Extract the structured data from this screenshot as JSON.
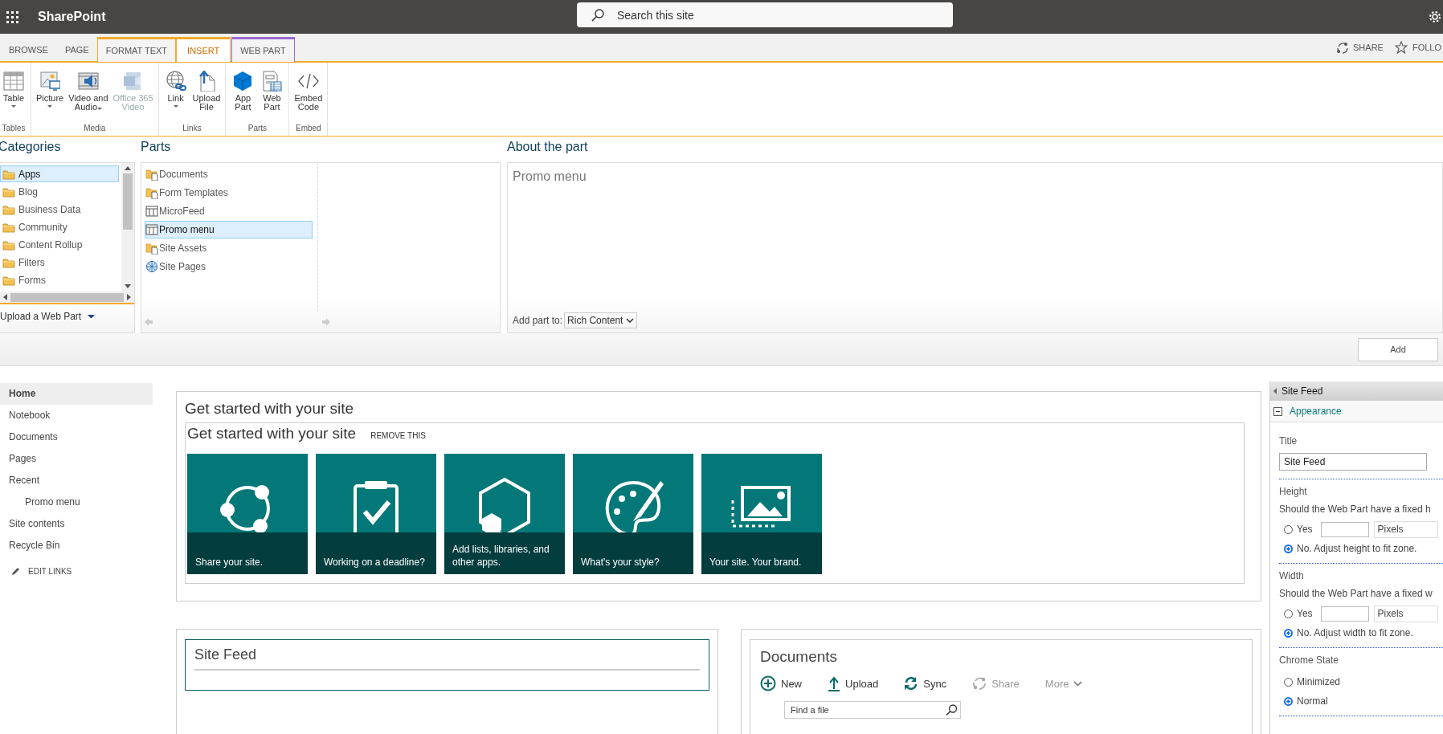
{
  "top_bar": {
    "app_name": "SharePoint",
    "search": {
      "placeholder": "Search this site"
    }
  },
  "ribbon_tabs": [
    {
      "label": "BROWSE",
      "selected": false,
      "kind": "plain"
    },
    {
      "label": "PAGE",
      "selected": false,
      "kind": "plain"
    },
    {
      "label": "FORMAT TEXT",
      "selected": false,
      "kind": "editing"
    },
    {
      "label": "INSERT",
      "selected": true,
      "kind": "editing"
    },
    {
      "label": "WEB PART",
      "selected": false,
      "kind": "webpart"
    }
  ],
  "page_actions": [
    {
      "label": "SHARE",
      "kind": "share"
    },
    {
      "label": "FOLLO",
      "kind": "follow"
    }
  ],
  "ribbon_groups": [
    {
      "label": "Tables",
      "commands": [
        {
          "lines": [
            "Table"
          ],
          "kind": "table",
          "dropdown": true,
          "disabled": false
        }
      ]
    },
    {
      "label": "Media",
      "commands": [
        {
          "lines": [
            "Picture"
          ],
          "kind": "picture",
          "dropdown": true,
          "disabled": false
        },
        {
          "lines": [
            "Video and",
            "Audio"
          ],
          "kind": "video",
          "dropdown": true,
          "disabled": false
        },
        {
          "lines": [
            "Office 365",
            "Video"
          ],
          "kind": "office-video",
          "dropdown": false,
          "disabled": true
        }
      ]
    },
    {
      "label": "Links",
      "commands": [
        {
          "lines": [
            "Link"
          ],
          "kind": "link",
          "dropdown": true,
          "disabled": false
        },
        {
          "lines": [
            "Upload",
            "File"
          ],
          "kind": "upload",
          "dropdown": false,
          "disabled": false
        }
      ]
    },
    {
      "label": "Parts",
      "commands": [
        {
          "lines": [
            "App",
            "Part"
          ],
          "kind": "app-part",
          "dropdown": false,
          "disabled": false
        },
        {
          "lines": [
            "Web",
            "Part"
          ],
          "kind": "web-part",
          "dropdown": false,
          "disabled": false
        }
      ]
    },
    {
      "label": "Embed",
      "commands": [
        {
          "lines": [
            "Embed",
            "Code"
          ],
          "kind": "embed",
          "dropdown": false,
          "disabled": false
        }
      ]
    }
  ],
  "categories": {
    "title": "Categories",
    "items": [
      {
        "label": "Apps",
        "selected": true
      },
      {
        "label": "Blog",
        "selected": false
      },
      {
        "label": "Business Data",
        "selected": false
      },
      {
        "label": "Community",
        "selected": false
      },
      {
        "label": "Content Rollup",
        "selected": false
      },
      {
        "label": "Filters",
        "selected": false
      },
      {
        "label": "Forms",
        "selected": false
      }
    ],
    "upload_link": "Upload a Web Part"
  },
  "parts": {
    "title": "Parts",
    "items": [
      {
        "label": "Documents",
        "kind": "library",
        "selected": false
      },
      {
        "label": "Form Templates",
        "kind": "library",
        "selected": false
      },
      {
        "label": "MicroFeed",
        "kind": "list",
        "selected": false
      },
      {
        "label": "Promo menu",
        "kind": "list",
        "selected": true
      },
      {
        "label": "Site Assets",
        "kind": "library",
        "selected": false
      },
      {
        "label": "Site Pages",
        "kind": "pages",
        "selected": false
      }
    ]
  },
  "about": {
    "title": "About the part",
    "part_name": "Promo menu",
    "add_to_label": "Add part to:",
    "add_to_value": "Rich Content"
  },
  "add_button": "Add",
  "quick_launch": {
    "items": [
      {
        "label": "Home",
        "selected": true
      },
      {
        "label": "Notebook",
        "selected": false
      },
      {
        "label": "Documents",
        "selected": false
      },
      {
        "label": "Pages",
        "selected": false
      },
      {
        "label": "Recent",
        "selected": false,
        "children": [
          {
            "label": "Promo menu",
            "selected": false
          }
        ]
      },
      {
        "label": "Site contents",
        "selected": false
      },
      {
        "label": "Recycle Bin",
        "selected": false
      }
    ],
    "edit_links": "EDIT LINKS"
  },
  "get_started": {
    "zone_title": "Get started with your site",
    "title": "Get started with your site",
    "remove_link": "REMOVE THIS",
    "tiles": [
      {
        "kind": "share",
        "caption": "Share your site."
      },
      {
        "kind": "deadline",
        "caption": "Working on a deadline?"
      },
      {
        "kind": "apps",
        "caption": "Add lists, libraries, and other apps."
      },
      {
        "kind": "style",
        "caption": "What's your style?"
      },
      {
        "kind": "brand",
        "caption": "Your site. Your brand."
      }
    ]
  },
  "site_feed": {
    "title": "Site Feed"
  },
  "documents": {
    "title": "Documents",
    "actions": [
      {
        "label": "New",
        "kind": "new",
        "disabled": false
      },
      {
        "label": "Upload",
        "kind": "upload",
        "disabled": false
      },
      {
        "label": "Sync",
        "kind": "sync",
        "disabled": false
      },
      {
        "label": "Share",
        "kind": "share",
        "disabled": true
      },
      {
        "label": "More",
        "kind": "more",
        "disabled": true
      }
    ],
    "search": {
      "placeholder": "Find a file"
    }
  },
  "tool_pane": {
    "title": "Site Feed",
    "section": {
      "label": "Appearance",
      "expanded": true
    },
    "groups": [
      {
        "kind": "text",
        "label": "Title",
        "value": "Site Feed"
      },
      {
        "kind": "radios",
        "label": "Height",
        "question": "Should the Web Part have a fixed h",
        "options": [
          {
            "label": "Yes",
            "selected": false,
            "unit": "Pixels"
          },
          {
            "label": "No. Adjust height to fit zone.",
            "selected": true
          }
        ]
      },
      {
        "kind": "radios",
        "label": "Width",
        "question": "Should the Web Part have a fixed w",
        "options": [
          {
            "label": "Yes",
            "selected": false,
            "unit": "Pixels"
          },
          {
            "label": "No. Adjust width to fit zone.",
            "selected": true
          }
        ]
      },
      {
        "kind": "radios",
        "label": "Chrome State",
        "options": [
          {
            "label": "Minimized",
            "selected": false
          },
          {
            "label": "Normal",
            "selected": true
          }
        ]
      }
    ]
  }
}
